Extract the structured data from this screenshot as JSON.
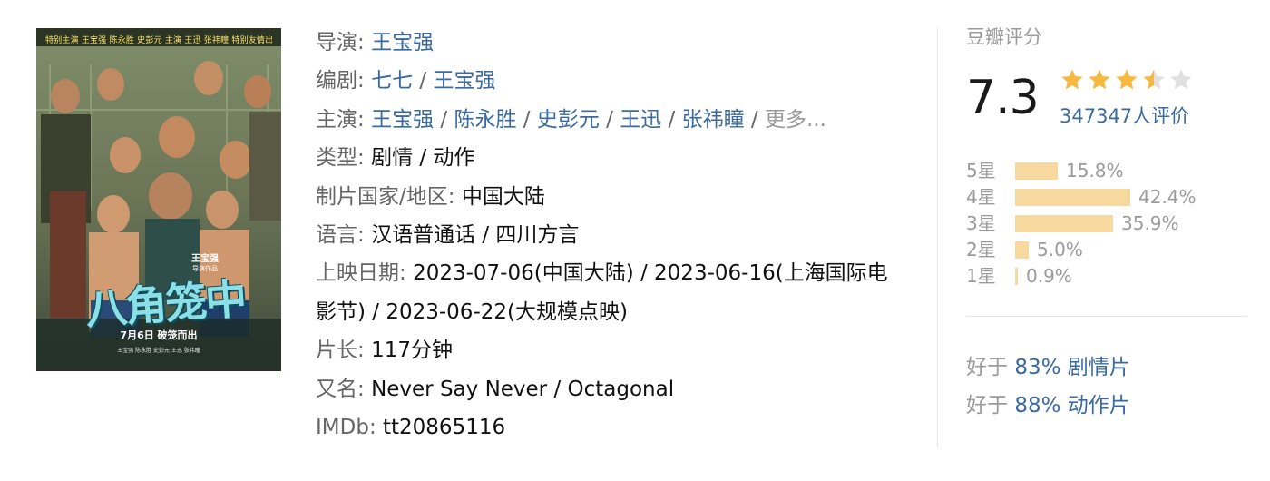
{
  "poster": {
    "credits_text": "特别主演 王宝强 陈永胜 史彭元 主演 王迅 张祎瞳 特别友情出演 肖央 刘桦",
    "director_name": "王宝强",
    "director_sub": "导演作品",
    "title_art": "八角笼中",
    "release_line": "7月6日  破笼而出",
    "fine_print": "王宝强 陈永胜 史彭元 王迅 张祎瞳"
  },
  "info": {
    "director": {
      "label": "导演",
      "names": [
        "王宝强"
      ]
    },
    "writer": {
      "label": "编剧",
      "names": [
        "七七",
        "王宝强"
      ]
    },
    "cast": {
      "label": "主演",
      "names": [
        "王宝强",
        "陈永胜",
        "史彭元",
        "王迅",
        "张祎瞳"
      ],
      "more": "更多..."
    },
    "genre": {
      "label": "类型",
      "value": "剧情 / 动作"
    },
    "country": {
      "label": "制片国家/地区",
      "value": "中国大陆"
    },
    "language": {
      "label": "语言",
      "value": "汉语普通话 / 四川方言"
    },
    "release": {
      "label": "上映日期",
      "value": "2023-07-06(中国大陆) / 2023-06-16(上海国际电影节) / 2023-06-22(大规模点映)"
    },
    "runtime": {
      "label": "片长",
      "value": "117分钟"
    },
    "aka": {
      "label": "又名",
      "value": "Never Say Never / Octagonal"
    },
    "imdb": {
      "label": "IMDb",
      "value": "tt20865116"
    }
  },
  "rating": {
    "title": "豆瓣评分",
    "score": "7.3",
    "stars": 3.5,
    "count_text": "347347人评价",
    "distribution": [
      {
        "label": "5星",
        "pct": "15.8%",
        "value": 15.8
      },
      {
        "label": "4星",
        "pct": "42.4%",
        "value": 42.4
      },
      {
        "label": "3星",
        "pct": "35.9%",
        "value": 35.9
      },
      {
        "label": "2星",
        "pct": "5.0%",
        "value": 5.0
      },
      {
        "label": "1星",
        "pct": "0.9%",
        "value": 0.9
      }
    ],
    "better_than": [
      {
        "prefix": "好于",
        "pct": "83%",
        "genre": "剧情片"
      },
      {
        "prefix": "好于",
        "pct": "88%",
        "genre": "动作片"
      }
    ]
  },
  "colors": {
    "link": "#3a6aa0",
    "bar": "#f7d89e",
    "star": "#f5b942",
    "star_empty": "#e0e0e0"
  }
}
